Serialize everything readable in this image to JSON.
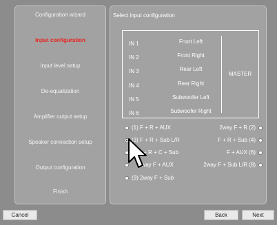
{
  "sidebar": {
    "items": [
      {
        "label": "Configuration wizard",
        "active": false
      },
      {
        "label": "Input configuration",
        "active": true
      },
      {
        "label": "Input level setup",
        "active": false
      },
      {
        "label": "De-equalization",
        "active": false
      },
      {
        "label": "Amplifier output setup",
        "active": false
      },
      {
        "label": "Speaker connection setup",
        "active": false
      },
      {
        "label": "Output configuration",
        "active": false
      },
      {
        "label": "Finish",
        "active": false
      }
    ]
  },
  "main": {
    "title": "Select input configuration",
    "inputs": [
      {
        "id": "IN 1",
        "name": "Front Left"
      },
      {
        "id": "IN 2",
        "name": "Front Right"
      },
      {
        "id": "IN 3",
        "name": "Rear Left"
      },
      {
        "id": "IN 4",
        "name": "Rear Right"
      },
      {
        "id": "IN 5",
        "name": "Subwoofer Left"
      },
      {
        "id": "IN 6",
        "name": "Subwoofer Right"
      }
    ],
    "master_label": "MASTER",
    "options_left": [
      {
        "label": "(1) F + R + AUX",
        "selected": false
      },
      {
        "label": "(3) F + R + Sub L/R",
        "selected": true
      },
      {
        "label": "F + R + C + Sub",
        "selected": false
      },
      {
        "label": "2way F + AUX",
        "selected": false
      },
      {
        "label": "(9) 2way F + Sub",
        "selected": false
      }
    ],
    "options_right": [
      {
        "label": "2way F + R (2)",
        "selected": false
      },
      {
        "label": "F + R + Sub (4)",
        "selected": false
      },
      {
        "label": "F + AUX (6)",
        "selected": false
      },
      {
        "label": "2way F + Sub L/R (8)",
        "selected": false
      }
    ]
  },
  "footer": {
    "cancel_label": "Cancel",
    "back_label": "Back",
    "next_label": "Next"
  }
}
